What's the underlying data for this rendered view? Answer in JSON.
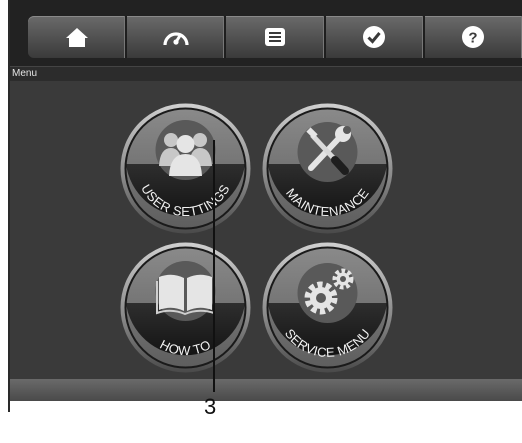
{
  "toolbar": {
    "buttons": [
      {
        "icon": "home-icon"
      },
      {
        "icon": "speedometer-icon"
      },
      {
        "icon": "list-icon"
      },
      {
        "icon": "checkmark-icon"
      },
      {
        "icon": "help-icon"
      }
    ]
  },
  "menu": {
    "title": "Menu"
  },
  "tiles": [
    {
      "label": "USER SETTINGS",
      "icon": "users-icon"
    },
    {
      "label": "MAINTENANCE",
      "icon": "tools-icon"
    },
    {
      "label": "HOW TO",
      "icon": "book-icon"
    },
    {
      "label": "SERVICE MENU",
      "icon": "gears-icon"
    }
  ],
  "annotation": {
    "callout_number": "3"
  }
}
